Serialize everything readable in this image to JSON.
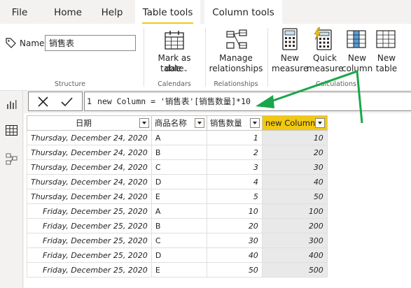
{
  "tabs": [
    "File",
    "Home",
    "Help",
    "Table tools",
    "Column tools"
  ],
  "structure": {
    "name_label": "Name",
    "name_value": "销售表",
    "group_label": "Structure"
  },
  "calendars": {
    "button_label_line1": "Mark as date",
    "button_label_line2": "table",
    "group_label": "Calendars"
  },
  "relationships": {
    "button_label_line1": "Manage",
    "button_label_line2": "relationships",
    "group_label": "Relationships"
  },
  "calculations": {
    "group_label": "Calculations",
    "buttons": [
      {
        "line1": "New",
        "line2": "measure"
      },
      {
        "line1": "Quick",
        "line2": "measure"
      },
      {
        "line1": "New",
        "line2": "column"
      },
      {
        "line1": "New",
        "line2": "table"
      }
    ]
  },
  "formula": {
    "line_number": "1",
    "text": "new Column = '销售表'[销售数量]*10"
  },
  "table": {
    "headers": [
      "日期",
      "商品名称",
      "销售数量",
      "new Column"
    ],
    "rows": [
      [
        "Thursday, December 24, 2020",
        "A",
        "1",
        "10"
      ],
      [
        "Thursday, December 24, 2020",
        "B",
        "2",
        "20"
      ],
      [
        "Thursday, December 24, 2020",
        "C",
        "3",
        "30"
      ],
      [
        "Thursday, December 24, 2020",
        "D",
        "4",
        "40"
      ],
      [
        "Thursday, December 24, 2020",
        "E",
        "5",
        "50"
      ],
      [
        "Friday, December 25, 2020",
        "A",
        "10",
        "100"
      ],
      [
        "Friday, December 25, 2020",
        "B",
        "20",
        "200"
      ],
      [
        "Friday, December 25, 2020",
        "C",
        "30",
        "300"
      ],
      [
        "Friday, December 25, 2020",
        "D",
        "40",
        "400"
      ],
      [
        "Friday, December 25, 2020",
        "E",
        "50",
        "500"
      ]
    ]
  },
  "colors": {
    "accent_yellow": "#f2c811",
    "annotation_arrow": "#1aa64a",
    "new_column_cell_bg": "#e9e9e9"
  },
  "icons": [
    "tag-icon",
    "calendar-grid-icon",
    "relationship-icon",
    "calculator-icon",
    "quick-measure-icon",
    "new-column-icon",
    "new-table-icon",
    "report-view-icon",
    "data-view-icon",
    "model-view-icon",
    "cancel-icon",
    "check-icon",
    "dropdown-icon"
  ]
}
